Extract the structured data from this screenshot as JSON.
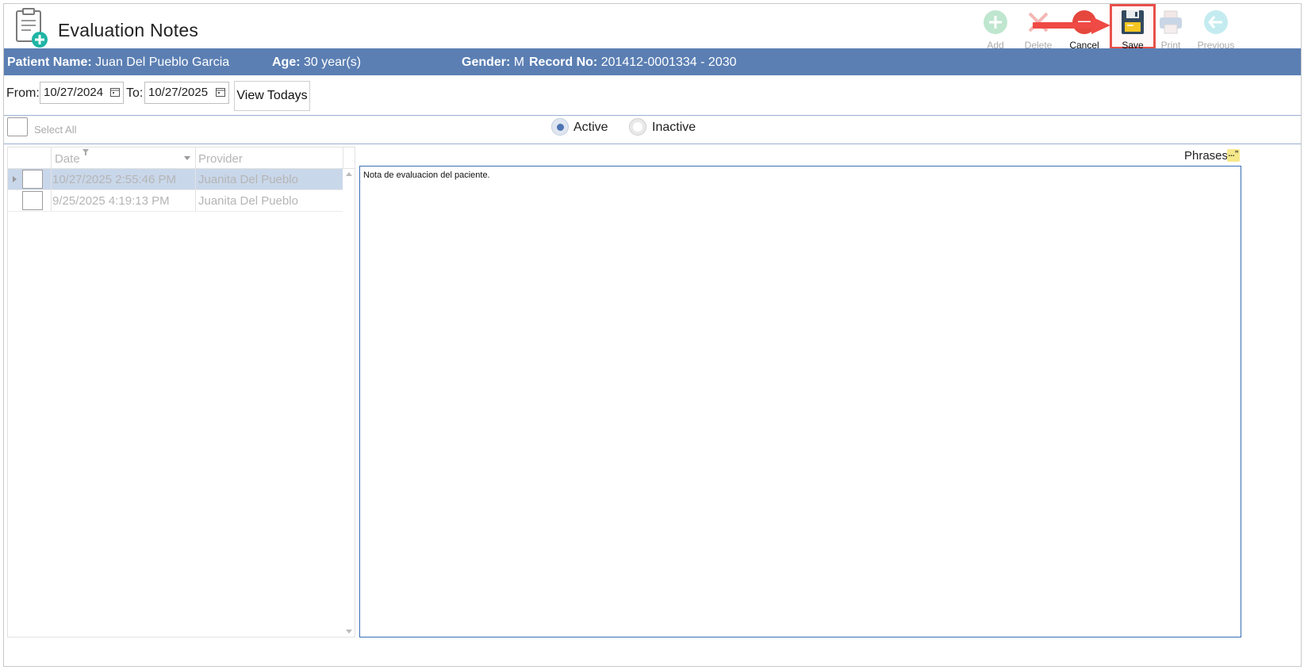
{
  "header": {
    "title": "Evaluation Notes"
  },
  "toolbar": {
    "add_label": "Add",
    "delete_label": "Delete",
    "cancel_label": "Cancel",
    "save_label": "Save",
    "print_label": "Print",
    "previous_label": "Previous"
  },
  "patient": {
    "name_label": "Patient Name:",
    "name_value": "Juan Del Pueblo Garcia",
    "age_label": "Age:",
    "age_value": "30 year(s)",
    "gender_label": "Gender:",
    "gender_value": "M",
    "record_label": "Record No:",
    "record_value": "201412-0001334 - 2030"
  },
  "filters": {
    "from_label": "From:",
    "from_value": "10/27/2024",
    "to_label": "To:",
    "to_value": "10/27/2025",
    "view_todays_label": "View Todays",
    "select_all_label": "Select All",
    "active_label": "Active",
    "inactive_label": "Inactive",
    "status_selected": "Active"
  },
  "grid": {
    "columns": [
      "Date",
      "Provider"
    ],
    "rows": [
      {
        "date": "10/27/2025 2:55:46 PM",
        "provider": "Juanita Del Pueblo",
        "selected": true
      },
      {
        "date": "9/25/2025 4:19:13 PM",
        "provider": "Juanita Del Pueblo",
        "selected": false
      }
    ]
  },
  "editor": {
    "phrases_label": "Phrases",
    "phrases_icon_text": "...”",
    "note_text": "Nota de evaluacion del paciente."
  },
  "colors": {
    "patient_bar": "#5b7fb3",
    "highlight": "#e8504a",
    "selected_row": "#c9d7ea"
  }
}
